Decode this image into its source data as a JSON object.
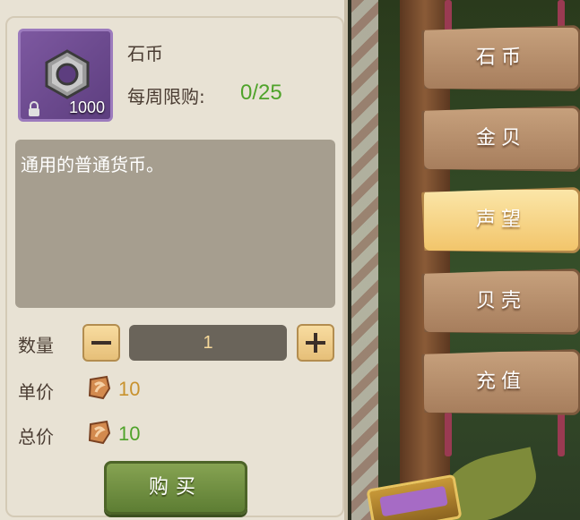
{
  "item": {
    "name": "石币",
    "weekly_limit_label": "每周限购:",
    "weekly_limit_value": "0/25",
    "badge_count": "1000",
    "icon": "stone-coin-nut-icon",
    "description": "通用的普通货币。"
  },
  "purchase": {
    "quantity_label": "数量",
    "quantity_value": "1",
    "unit_price_label": "单价",
    "unit_price_value": "10",
    "total_price_label": "总价",
    "total_price_value": "10",
    "currency_icon": "stone-currency-icon",
    "buy_label": "购买"
  },
  "nav": {
    "items": [
      {
        "label": "石币",
        "active": false
      },
      {
        "label": "金贝",
        "active": false
      },
      {
        "label": "声望",
        "active": true
      },
      {
        "label": "贝壳",
        "active": false
      },
      {
        "label": "充值",
        "active": false
      }
    ]
  },
  "colors": {
    "limit_green": "#4fa32a",
    "total_green": "#4fa32a",
    "price_gold": "#c8922e",
    "active_tab": "#f2c56b"
  }
}
